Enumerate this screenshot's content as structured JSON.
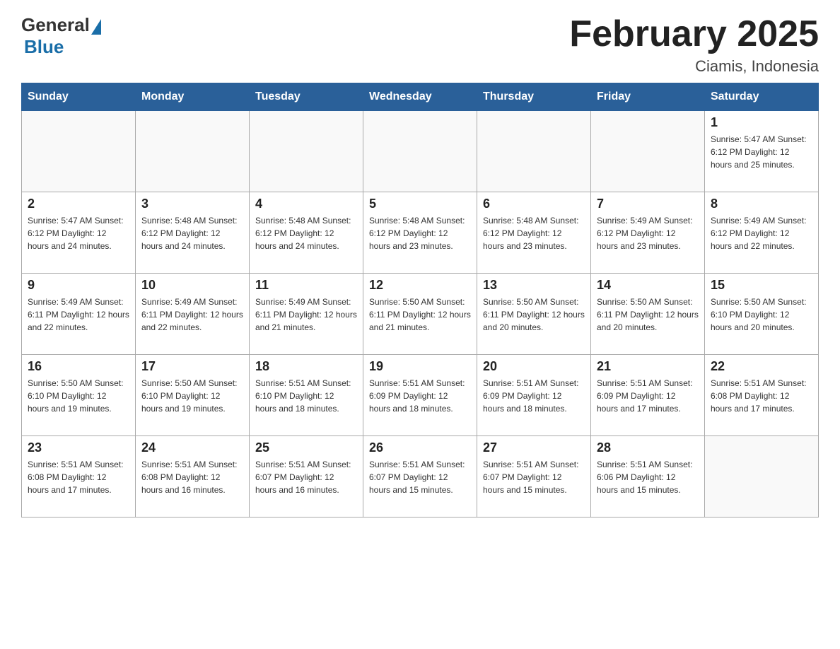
{
  "header": {
    "logo_general": "General",
    "logo_blue": "Blue",
    "month_title": "February 2025",
    "location": "Ciamis, Indonesia"
  },
  "weekdays": [
    "Sunday",
    "Monday",
    "Tuesday",
    "Wednesday",
    "Thursday",
    "Friday",
    "Saturday"
  ],
  "weeks": [
    [
      {
        "day": "",
        "info": ""
      },
      {
        "day": "",
        "info": ""
      },
      {
        "day": "",
        "info": ""
      },
      {
        "day": "",
        "info": ""
      },
      {
        "day": "",
        "info": ""
      },
      {
        "day": "",
        "info": ""
      },
      {
        "day": "1",
        "info": "Sunrise: 5:47 AM\nSunset: 6:12 PM\nDaylight: 12 hours and 25 minutes."
      }
    ],
    [
      {
        "day": "2",
        "info": "Sunrise: 5:47 AM\nSunset: 6:12 PM\nDaylight: 12 hours and 24 minutes."
      },
      {
        "day": "3",
        "info": "Sunrise: 5:48 AM\nSunset: 6:12 PM\nDaylight: 12 hours and 24 minutes."
      },
      {
        "day": "4",
        "info": "Sunrise: 5:48 AM\nSunset: 6:12 PM\nDaylight: 12 hours and 24 minutes."
      },
      {
        "day": "5",
        "info": "Sunrise: 5:48 AM\nSunset: 6:12 PM\nDaylight: 12 hours and 23 minutes."
      },
      {
        "day": "6",
        "info": "Sunrise: 5:48 AM\nSunset: 6:12 PM\nDaylight: 12 hours and 23 minutes."
      },
      {
        "day": "7",
        "info": "Sunrise: 5:49 AM\nSunset: 6:12 PM\nDaylight: 12 hours and 23 minutes."
      },
      {
        "day": "8",
        "info": "Sunrise: 5:49 AM\nSunset: 6:12 PM\nDaylight: 12 hours and 22 minutes."
      }
    ],
    [
      {
        "day": "9",
        "info": "Sunrise: 5:49 AM\nSunset: 6:11 PM\nDaylight: 12 hours and 22 minutes."
      },
      {
        "day": "10",
        "info": "Sunrise: 5:49 AM\nSunset: 6:11 PM\nDaylight: 12 hours and 22 minutes."
      },
      {
        "day": "11",
        "info": "Sunrise: 5:49 AM\nSunset: 6:11 PM\nDaylight: 12 hours and 21 minutes."
      },
      {
        "day": "12",
        "info": "Sunrise: 5:50 AM\nSunset: 6:11 PM\nDaylight: 12 hours and 21 minutes."
      },
      {
        "day": "13",
        "info": "Sunrise: 5:50 AM\nSunset: 6:11 PM\nDaylight: 12 hours and 20 minutes."
      },
      {
        "day": "14",
        "info": "Sunrise: 5:50 AM\nSunset: 6:11 PM\nDaylight: 12 hours and 20 minutes."
      },
      {
        "day": "15",
        "info": "Sunrise: 5:50 AM\nSunset: 6:10 PM\nDaylight: 12 hours and 20 minutes."
      }
    ],
    [
      {
        "day": "16",
        "info": "Sunrise: 5:50 AM\nSunset: 6:10 PM\nDaylight: 12 hours and 19 minutes."
      },
      {
        "day": "17",
        "info": "Sunrise: 5:50 AM\nSunset: 6:10 PM\nDaylight: 12 hours and 19 minutes."
      },
      {
        "day": "18",
        "info": "Sunrise: 5:51 AM\nSunset: 6:10 PM\nDaylight: 12 hours and 18 minutes."
      },
      {
        "day": "19",
        "info": "Sunrise: 5:51 AM\nSunset: 6:09 PM\nDaylight: 12 hours and 18 minutes."
      },
      {
        "day": "20",
        "info": "Sunrise: 5:51 AM\nSunset: 6:09 PM\nDaylight: 12 hours and 18 minutes."
      },
      {
        "day": "21",
        "info": "Sunrise: 5:51 AM\nSunset: 6:09 PM\nDaylight: 12 hours and 17 minutes."
      },
      {
        "day": "22",
        "info": "Sunrise: 5:51 AM\nSunset: 6:08 PM\nDaylight: 12 hours and 17 minutes."
      }
    ],
    [
      {
        "day": "23",
        "info": "Sunrise: 5:51 AM\nSunset: 6:08 PM\nDaylight: 12 hours and 17 minutes."
      },
      {
        "day": "24",
        "info": "Sunrise: 5:51 AM\nSunset: 6:08 PM\nDaylight: 12 hours and 16 minutes."
      },
      {
        "day": "25",
        "info": "Sunrise: 5:51 AM\nSunset: 6:07 PM\nDaylight: 12 hours and 16 minutes."
      },
      {
        "day": "26",
        "info": "Sunrise: 5:51 AM\nSunset: 6:07 PM\nDaylight: 12 hours and 15 minutes."
      },
      {
        "day": "27",
        "info": "Sunrise: 5:51 AM\nSunset: 6:07 PM\nDaylight: 12 hours and 15 minutes."
      },
      {
        "day": "28",
        "info": "Sunrise: 5:51 AM\nSunset: 6:06 PM\nDaylight: 12 hours and 15 minutes."
      },
      {
        "day": "",
        "info": ""
      }
    ]
  ]
}
